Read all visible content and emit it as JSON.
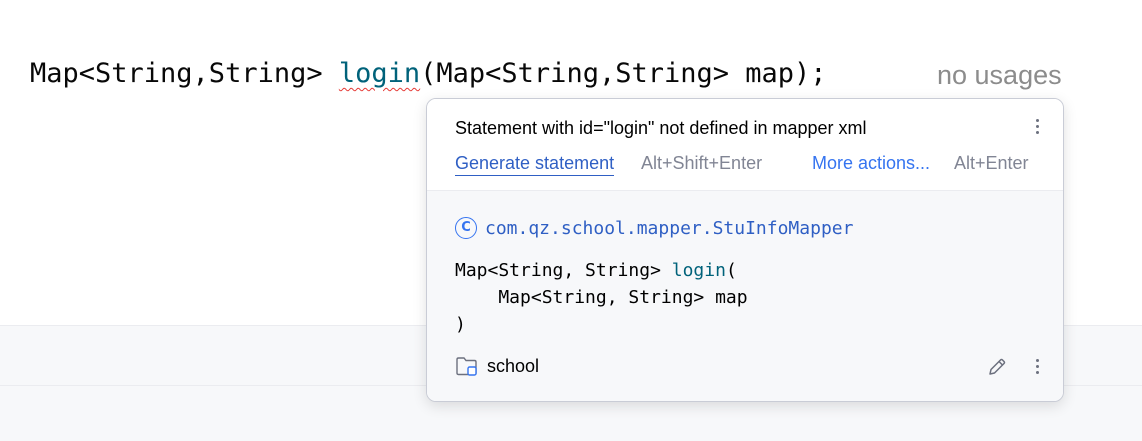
{
  "editor": {
    "code": {
      "return_type": "Map<String,String> ",
      "method_name": "login",
      "params": "(Map<String,String> map);"
    },
    "usages_hint": "no usages"
  },
  "popup": {
    "message": "Statement with id=\"login\" not defined in mapper xml",
    "primary_action": {
      "label": "Generate statement",
      "shortcut": "Alt+Shift+Enter"
    },
    "more_actions": {
      "label": "More actions...",
      "shortcut": "Alt+Enter"
    },
    "class_fqn": "com.qz.school.mapper.StuInfoMapper",
    "class_icon_glyph": "C",
    "signature": {
      "line1_prefix": "Map<String, String> ",
      "method_name": "login",
      "line1_suffix": "(",
      "line2": "    Map<String, String> map",
      "line3": ")"
    },
    "module": "school"
  },
  "colors": {
    "keyword_method": "#00627a",
    "link": "#3574f0",
    "hint": "#8c8c8c",
    "error_underline": "#e53935"
  },
  "icons": {
    "class": "class-icon",
    "folder": "module-folder-icon",
    "edit": "pencil-icon",
    "menu": "kebab-menu-icon"
  }
}
